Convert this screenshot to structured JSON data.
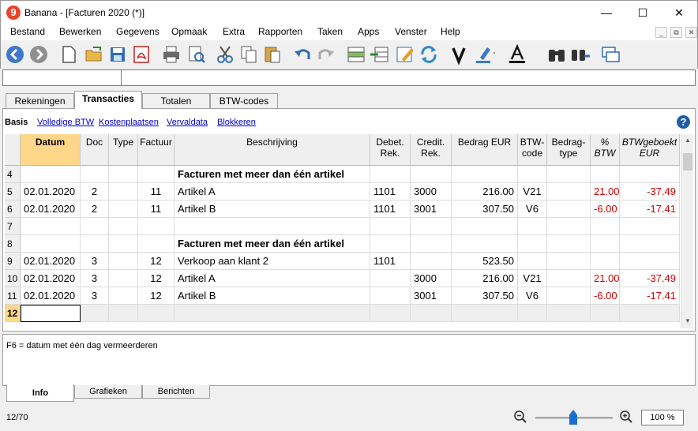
{
  "window": {
    "title": "Banana - [Facturen 2020 (*)]",
    "logo_glyph": "9",
    "minimize_glyph": "—",
    "maximize_glyph": "☐",
    "close_glyph": "✕"
  },
  "menu": [
    "Bestand",
    "Bewerken",
    "Gegevens",
    "Opmaak",
    "Extra",
    "Rapporten",
    "Taken",
    "Apps",
    "Venster",
    "Help"
  ],
  "mdi": {
    "minimize": "_",
    "restore": "⧉",
    "close": "✕"
  },
  "toolbar_icons": [
    "back-icon",
    "forward-icon",
    "new-file-icon",
    "open-folder-icon",
    "save-icon",
    "pdf-icon",
    "print-icon",
    "print-preview-icon",
    "cut-icon",
    "copy-icon",
    "paste-icon",
    "undo-icon",
    "redo-icon",
    "insert-row-icon",
    "delete-row-icon",
    "edit-icon",
    "recalculate-icon",
    "check-icon",
    "highlight-icon",
    "font-color-icon",
    "find-icon",
    "replace-icon",
    "window-icon"
  ],
  "tabs": [
    "Rekeningen",
    "Transacties",
    "Totalen",
    "BTW-codes"
  ],
  "active_tab": "Transacties",
  "views": [
    "Basis",
    "Volledige BTW",
    "Kostenplaatsen",
    "Vervaldata",
    "Blokkeren"
  ],
  "help_glyph": "?",
  "columns": [
    {
      "line1": "Datum",
      "line2": ""
    },
    {
      "line1": "Doc",
      "line2": ""
    },
    {
      "line1": "Type",
      "line2": ""
    },
    {
      "line1": "Factuur",
      "line2": ""
    },
    {
      "line1": "Beschrijving",
      "line2": ""
    },
    {
      "line1": "Debet.",
      "line2": "Rek."
    },
    {
      "line1": "Credit.",
      "line2": "Rek."
    },
    {
      "line1": "Bedrag EUR",
      "line2": ""
    },
    {
      "line1": "BTW-",
      "line2": "code"
    },
    {
      "line1": "Bedrag-",
      "line2": "type"
    },
    {
      "line1": "%",
      "line2": "BTW"
    },
    {
      "line1": "BTWgeboekt",
      "line2": "EUR"
    }
  ],
  "rows": [
    {
      "num": "4",
      "datum": "",
      "doc": "",
      "type": "",
      "factuur": "",
      "beschrijving": "Facturen met meer dan één artikel",
      "debet": "",
      "credit": "",
      "bedrag": "",
      "btwcode": "",
      "bedragtype": "",
      "pct": "",
      "btwgeboekt": "",
      "header": true
    },
    {
      "num": "5",
      "datum": "02.01.2020",
      "doc": "2",
      "type": "",
      "factuur": "11",
      "beschrijving": "Artikel A",
      "debet": "1101",
      "credit": "3000",
      "bedrag": "216.00",
      "btwcode": "V21",
      "bedragtype": "",
      "pct": "21.00",
      "btwgeboekt": "-37.49"
    },
    {
      "num": "6",
      "datum": "02.01.2020",
      "doc": "2",
      "type": "",
      "factuur": "11",
      "beschrijving": "Artikel B",
      "debet": "1101",
      "credit": "3001",
      "bedrag": "307.50",
      "btwcode": "V6",
      "bedragtype": "",
      "pct": "-6.00",
      "btwgeboekt": "-17.41"
    },
    {
      "num": "7",
      "datum": "",
      "doc": "",
      "type": "",
      "factuur": "",
      "beschrijving": "",
      "debet": "",
      "credit": "",
      "bedrag": "",
      "btwcode": "",
      "bedragtype": "",
      "pct": "",
      "btwgeboekt": ""
    },
    {
      "num": "8",
      "datum": "",
      "doc": "",
      "type": "",
      "factuur": "",
      "beschrijving": "Facturen met meer dan één artikel",
      "debet": "",
      "credit": "",
      "bedrag": "",
      "btwcode": "",
      "bedragtype": "",
      "pct": "",
      "btwgeboekt": "",
      "header": true
    },
    {
      "num": "9",
      "datum": "02.01.2020",
      "doc": "3",
      "type": "",
      "factuur": "12",
      "beschrijving": "Verkoop aan klant 2",
      "debet": "1101",
      "credit": "",
      "bedrag": "523.50",
      "btwcode": "",
      "bedragtype": "",
      "pct": "",
      "btwgeboekt": ""
    },
    {
      "num": "10",
      "datum": "02.01.2020",
      "doc": "3",
      "type": "",
      "factuur": "12",
      "beschrijving": "Artikel A",
      "debet": "",
      "credit": "3000",
      "bedrag": "216.00",
      "btwcode": "V21",
      "bedragtype": "",
      "pct": "21.00",
      "btwgeboekt": "-37.49"
    },
    {
      "num": "11",
      "datum": "02.01.2020",
      "doc": "3",
      "type": "",
      "factuur": "12",
      "beschrijving": "Artikel B",
      "debet": "",
      "credit": "3001",
      "bedrag": "307.50",
      "btwcode": "V6",
      "bedragtype": "",
      "pct": "-6.00",
      "btwgeboekt": "-17.41"
    },
    {
      "num": "12",
      "datum": "",
      "doc": "",
      "type": "",
      "factuur": "",
      "beschrijving": "",
      "debet": "",
      "credit": "",
      "bedrag": "",
      "btwcode": "",
      "bedragtype": "",
      "pct": "",
      "btwgeboekt": "",
      "current": true
    }
  ],
  "scroll": {
    "up_glyph": "▲",
    "down_glyph": "▼"
  },
  "info_text": "F6 = datum met één dag vermeerderen",
  "bottom_tabs": [
    "Info",
    "Grafieken",
    "Berichten"
  ],
  "status": {
    "position": "12/70",
    "zoom": "100 %"
  }
}
